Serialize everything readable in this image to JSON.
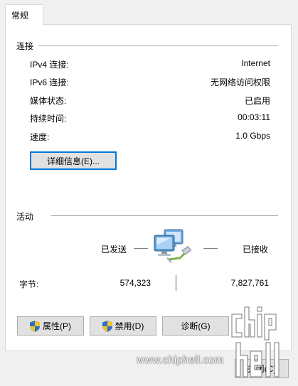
{
  "tab": {
    "general": "常规"
  },
  "connection": {
    "title": "连接",
    "rows": [
      {
        "label": "IPv4 连接:",
        "value": "Internet"
      },
      {
        "label": "IPv6 连接:",
        "value": "无网络访问权限"
      },
      {
        "label": "媒体状态:",
        "value": "已启用"
      },
      {
        "label": "持续时间:",
        "value": "00:03:11"
      },
      {
        "label": "速度:",
        "value": "1.0 Gbps"
      }
    ],
    "details_button": "详细信息(E)..."
  },
  "activity": {
    "title": "活动",
    "sent_label": "已发送",
    "received_label": "已接收",
    "bytes_label": "字节:",
    "bytes_sent": "574,323",
    "bytes_received": "7,827,761"
  },
  "buttons": {
    "properties": "属性(P)",
    "disable": "禁用(D)",
    "diagnose": "诊断(G)",
    "close": "关闭(C)"
  },
  "watermark": {
    "url": "www.chiphell.com",
    "logo_text": "chip hell"
  },
  "icons": {
    "network": "network-computers-icon",
    "shield": "uac-shield-icon"
  }
}
